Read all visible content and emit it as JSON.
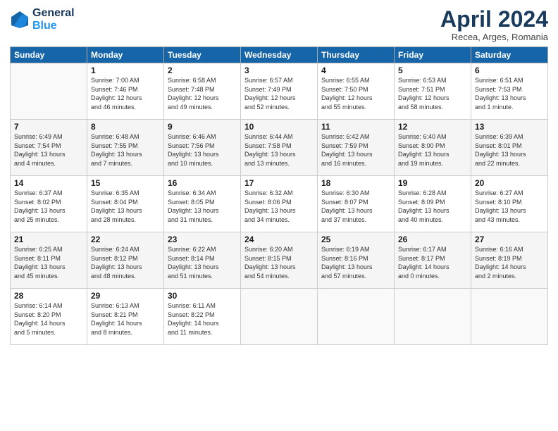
{
  "header": {
    "logo_line1": "General",
    "logo_line2": "Blue",
    "title": "April 2024",
    "subtitle": "Recea, Arges, Romania"
  },
  "days_of_week": [
    "Sunday",
    "Monday",
    "Tuesday",
    "Wednesday",
    "Thursday",
    "Friday",
    "Saturday"
  ],
  "weeks": [
    [
      {
        "day": "",
        "detail": ""
      },
      {
        "day": "1",
        "detail": "Sunrise: 7:00 AM\nSunset: 7:46 PM\nDaylight: 12 hours\nand 46 minutes."
      },
      {
        "day": "2",
        "detail": "Sunrise: 6:58 AM\nSunset: 7:48 PM\nDaylight: 12 hours\nand 49 minutes."
      },
      {
        "day": "3",
        "detail": "Sunrise: 6:57 AM\nSunset: 7:49 PM\nDaylight: 12 hours\nand 52 minutes."
      },
      {
        "day": "4",
        "detail": "Sunrise: 6:55 AM\nSunset: 7:50 PM\nDaylight: 12 hours\nand 55 minutes."
      },
      {
        "day": "5",
        "detail": "Sunrise: 6:53 AM\nSunset: 7:51 PM\nDaylight: 12 hours\nand 58 minutes."
      },
      {
        "day": "6",
        "detail": "Sunrise: 6:51 AM\nSunset: 7:53 PM\nDaylight: 13 hours\nand 1 minute."
      }
    ],
    [
      {
        "day": "7",
        "detail": "Sunrise: 6:49 AM\nSunset: 7:54 PM\nDaylight: 13 hours\nand 4 minutes."
      },
      {
        "day": "8",
        "detail": "Sunrise: 6:48 AM\nSunset: 7:55 PM\nDaylight: 13 hours\nand 7 minutes."
      },
      {
        "day": "9",
        "detail": "Sunrise: 6:46 AM\nSunset: 7:56 PM\nDaylight: 13 hours\nand 10 minutes."
      },
      {
        "day": "10",
        "detail": "Sunrise: 6:44 AM\nSunset: 7:58 PM\nDaylight: 13 hours\nand 13 minutes."
      },
      {
        "day": "11",
        "detail": "Sunrise: 6:42 AM\nSunset: 7:59 PM\nDaylight: 13 hours\nand 16 minutes."
      },
      {
        "day": "12",
        "detail": "Sunrise: 6:40 AM\nSunset: 8:00 PM\nDaylight: 13 hours\nand 19 minutes."
      },
      {
        "day": "13",
        "detail": "Sunrise: 6:39 AM\nSunset: 8:01 PM\nDaylight: 13 hours\nand 22 minutes."
      }
    ],
    [
      {
        "day": "14",
        "detail": "Sunrise: 6:37 AM\nSunset: 8:02 PM\nDaylight: 13 hours\nand 25 minutes."
      },
      {
        "day": "15",
        "detail": "Sunrise: 6:35 AM\nSunset: 8:04 PM\nDaylight: 13 hours\nand 28 minutes."
      },
      {
        "day": "16",
        "detail": "Sunrise: 6:34 AM\nSunset: 8:05 PM\nDaylight: 13 hours\nand 31 minutes."
      },
      {
        "day": "17",
        "detail": "Sunrise: 6:32 AM\nSunset: 8:06 PM\nDaylight: 13 hours\nand 34 minutes."
      },
      {
        "day": "18",
        "detail": "Sunrise: 6:30 AM\nSunset: 8:07 PM\nDaylight: 13 hours\nand 37 minutes."
      },
      {
        "day": "19",
        "detail": "Sunrise: 6:28 AM\nSunset: 8:09 PM\nDaylight: 13 hours\nand 40 minutes."
      },
      {
        "day": "20",
        "detail": "Sunrise: 6:27 AM\nSunset: 8:10 PM\nDaylight: 13 hours\nand 43 minutes."
      }
    ],
    [
      {
        "day": "21",
        "detail": "Sunrise: 6:25 AM\nSunset: 8:11 PM\nDaylight: 13 hours\nand 45 minutes."
      },
      {
        "day": "22",
        "detail": "Sunrise: 6:24 AM\nSunset: 8:12 PM\nDaylight: 13 hours\nand 48 minutes."
      },
      {
        "day": "23",
        "detail": "Sunrise: 6:22 AM\nSunset: 8:14 PM\nDaylight: 13 hours\nand 51 minutes."
      },
      {
        "day": "24",
        "detail": "Sunrise: 6:20 AM\nSunset: 8:15 PM\nDaylight: 13 hours\nand 54 minutes."
      },
      {
        "day": "25",
        "detail": "Sunrise: 6:19 AM\nSunset: 8:16 PM\nDaylight: 13 hours\nand 57 minutes."
      },
      {
        "day": "26",
        "detail": "Sunrise: 6:17 AM\nSunset: 8:17 PM\nDaylight: 14 hours\nand 0 minutes."
      },
      {
        "day": "27",
        "detail": "Sunrise: 6:16 AM\nSunset: 8:19 PM\nDaylight: 14 hours\nand 2 minutes."
      }
    ],
    [
      {
        "day": "28",
        "detail": "Sunrise: 6:14 AM\nSunset: 8:20 PM\nDaylight: 14 hours\nand 5 minutes."
      },
      {
        "day": "29",
        "detail": "Sunrise: 6:13 AM\nSunset: 8:21 PM\nDaylight: 14 hours\nand 8 minutes."
      },
      {
        "day": "30",
        "detail": "Sunrise: 6:11 AM\nSunset: 8:22 PM\nDaylight: 14 hours\nand 11 minutes."
      },
      {
        "day": "",
        "detail": ""
      },
      {
        "day": "",
        "detail": ""
      },
      {
        "day": "",
        "detail": ""
      },
      {
        "day": "",
        "detail": ""
      }
    ]
  ]
}
